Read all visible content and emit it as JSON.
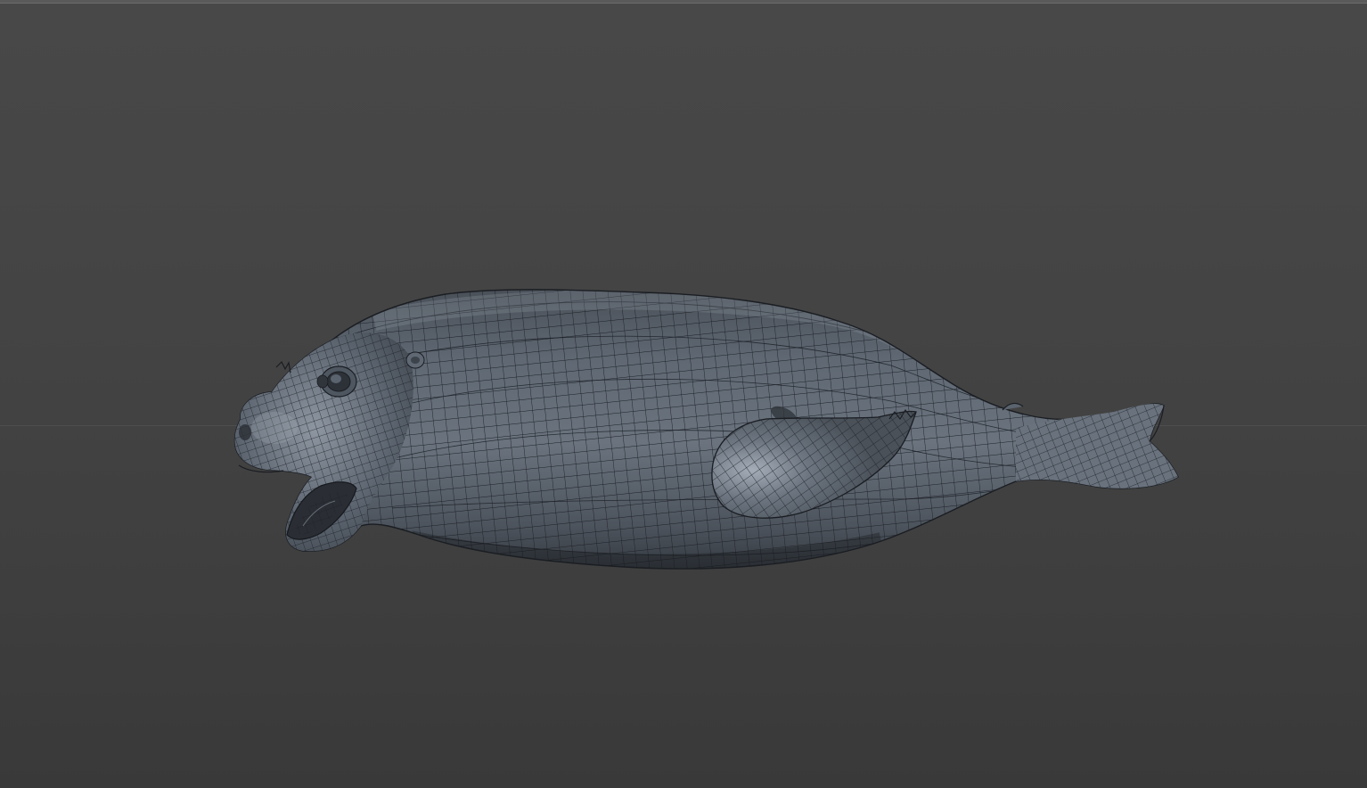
{
  "viewport": {
    "background_color": "#454545",
    "horizon_line_color": "#575757",
    "border_color": "#6c6c6c"
  },
  "model": {
    "subject": "seal-mesh",
    "display_mode": "shaded-wireframe",
    "surface_color": "#5b6470",
    "wire_color": "#1c1f24",
    "highlight_color": "#a7b0bb"
  }
}
